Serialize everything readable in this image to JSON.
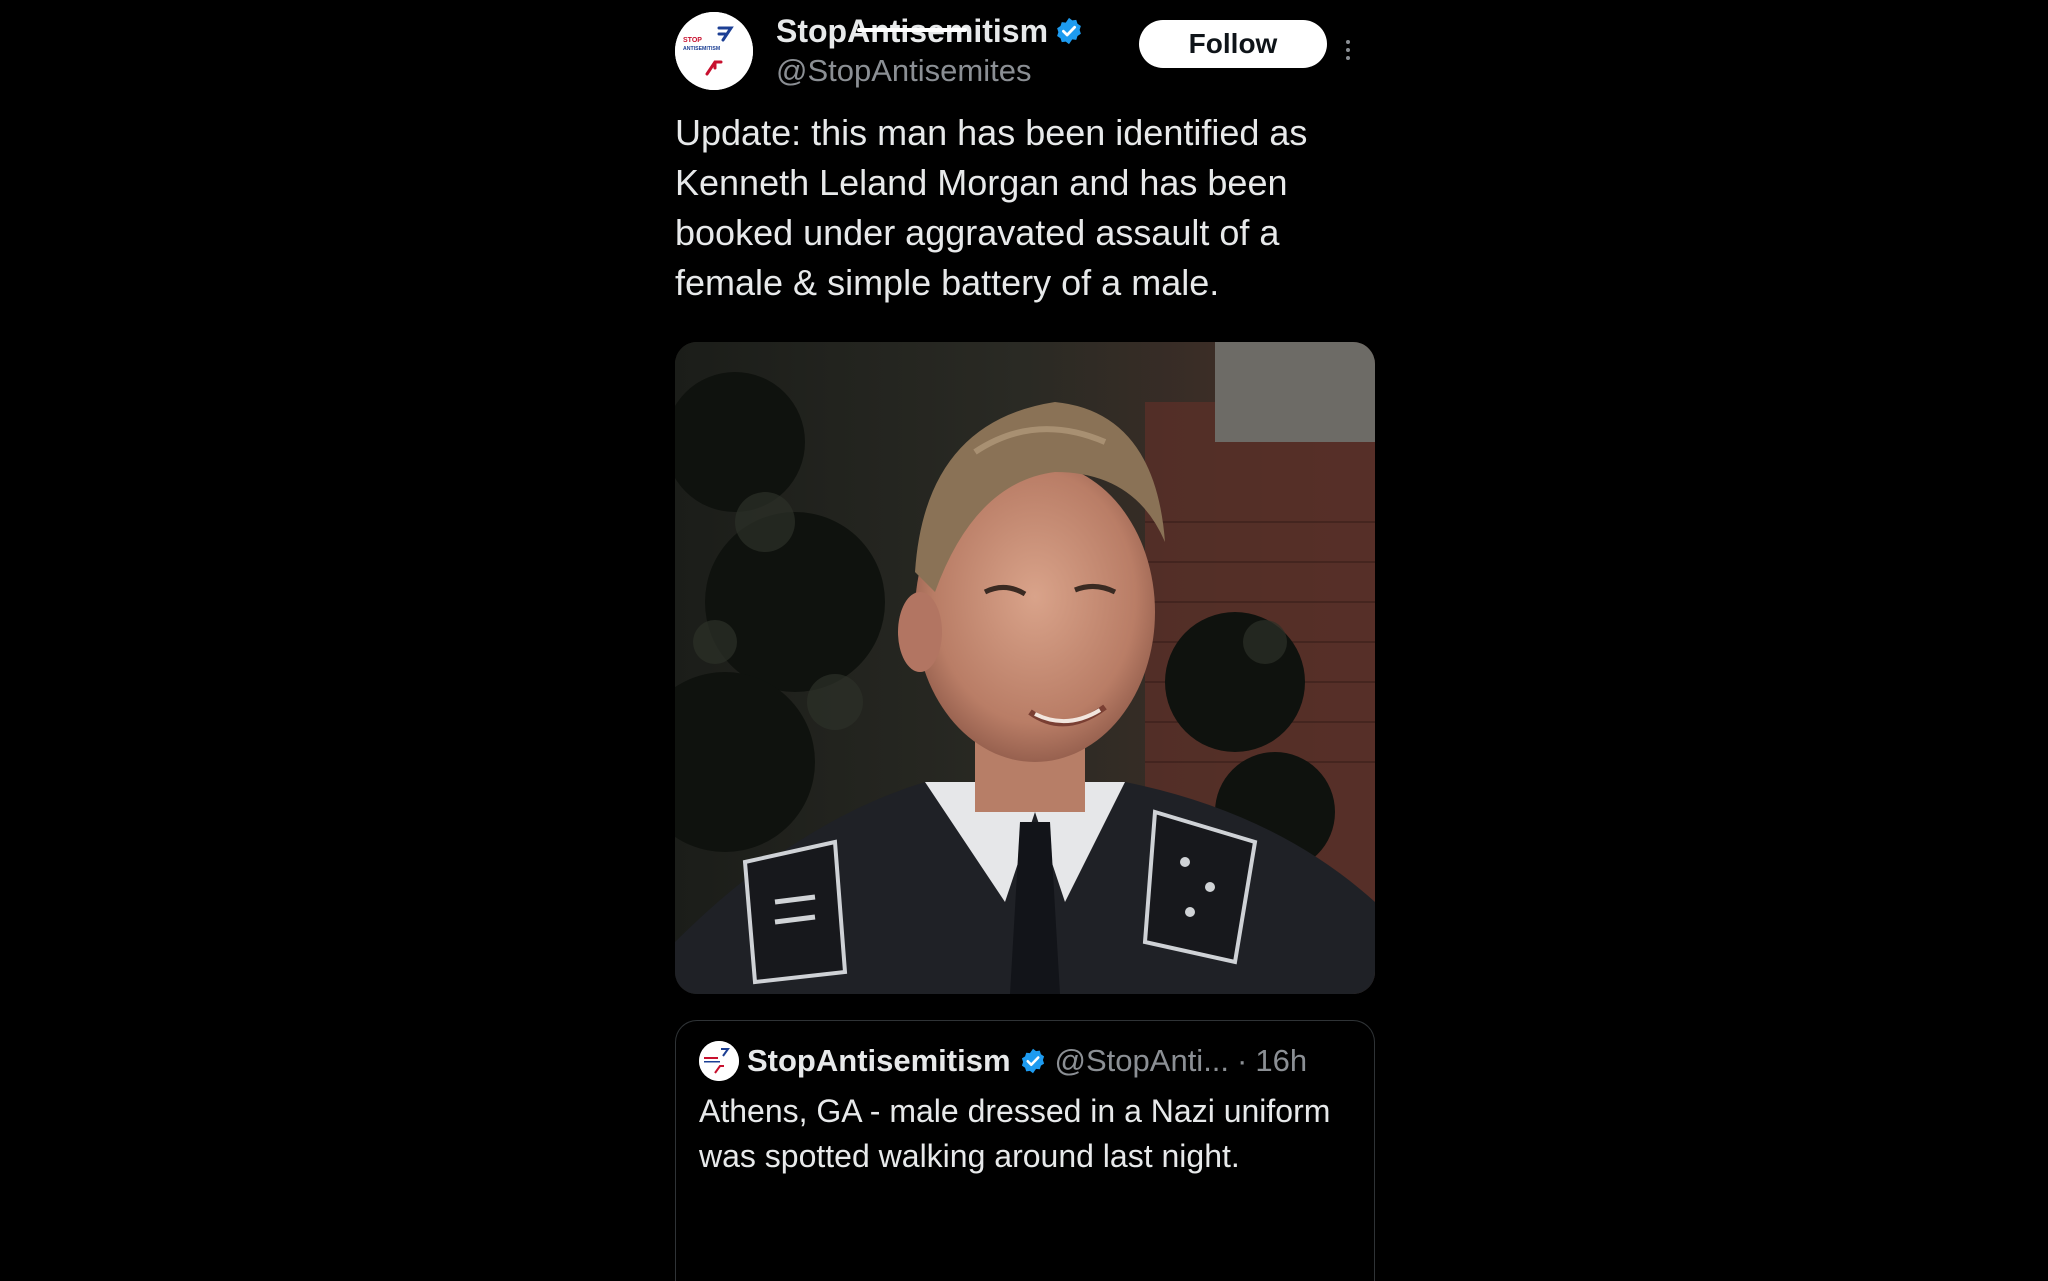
{
  "post": {
    "display_name": "StopAntisemitism",
    "handle": "@StopAntisemites",
    "avatar_icon": "stop-antisemitism-logo-icon",
    "avatar_logo_text": [
      "STOP",
      "ANTISEMITISM"
    ],
    "verified_icon": "verified-badge-icon",
    "verified_color": "#1d9bf0",
    "follow_label": "Follow",
    "more_icon": "more-options-icon",
    "text": "Update: this man has been identified as Kenneth Leland Morgan and has been booked under aggravated assault of a female & simple battery of a male.",
    "media_icon": "photo-man-in-uniform"
  },
  "quote": {
    "display_name": "StopAntisemitism",
    "handle": "@StopAnti...",
    "separator": "·",
    "time": "16h",
    "text": "Athens, GA - male dressed in a Nazi uniform was spotted walking around last night."
  }
}
